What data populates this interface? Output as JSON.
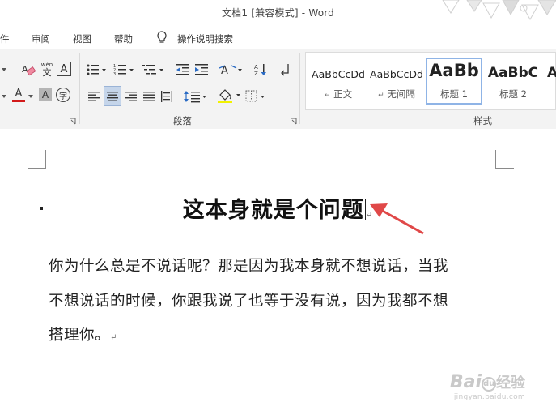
{
  "window": {
    "title": "文档1 [兼容模式]  -  Word"
  },
  "menu": {
    "items": [
      {
        "key": "file",
        "label": "件"
      },
      {
        "key": "review",
        "label": "审阅"
      },
      {
        "key": "view",
        "label": "视图"
      },
      {
        "key": "help",
        "label": "帮助"
      }
    ],
    "tell_me": "操作说明搜索"
  },
  "ribbon": {
    "groups": {
      "paragraph": "段落",
      "styles": "样式"
    },
    "phonetic_guide_top": "wén",
    "phonetic_guide_bottom": "文",
    "enclose_char": "字",
    "char_border": "A",
    "char_shading": "A",
    "font_color_glyph": "A",
    "accent_colors": {
      "font_color": "#d21a1a",
      "highlight": "#f2f200",
      "selected_style_border": "#8fb4e6"
    },
    "styles": [
      {
        "sample": "AaBbCcDd",
        "name": "正文"
      },
      {
        "sample": "AaBbCcDd",
        "name": "无间隔"
      },
      {
        "sample": "AaBb",
        "name": "标题 1",
        "selected": true
      },
      {
        "sample": "AaBbC",
        "name": "标题 2"
      },
      {
        "sample": "A",
        "name": ""
      }
    ]
  },
  "document": {
    "heading": "这本身就是个问题",
    "paragraph_lines": [
      "你为什么总是不说话呢？那是因为我本身就不想说话，当我",
      "不想说话的时候，你跟我说了也等于没有说，因为我都不想",
      "搭理你。"
    ]
  },
  "watermark": {
    "brand": "Bai",
    "brand_suffix": "经验",
    "url": "jingyan.baidu.com"
  }
}
